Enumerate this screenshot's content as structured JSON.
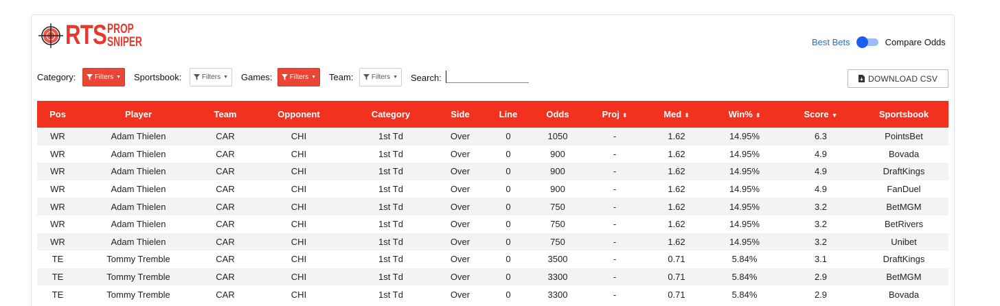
{
  "logo": {
    "main": "RTS",
    "line1": "PROP",
    "line2": "SNIPER"
  },
  "mode_toggle": {
    "left_label": "Best Bets",
    "right_label": "Compare Odds",
    "state": "best-bets"
  },
  "filters": [
    {
      "label": "Category:",
      "button": "Filters",
      "active": true
    },
    {
      "label": "Sportsbook:",
      "button": "Filters",
      "active": false
    },
    {
      "label": "Games:",
      "button": "Filters",
      "active": true
    },
    {
      "label": "Team:",
      "button": "Filters",
      "active": false
    }
  ],
  "search": {
    "label": "Search:",
    "value": ""
  },
  "download_button": "DOWNLOAD CSV",
  "table": {
    "columns": [
      "Pos",
      "Player",
      "Team",
      "Opponent",
      "Category",
      "Side",
      "Line",
      "Odds",
      "Proj",
      "Med",
      "Win%",
      "Score",
      "Sportsbook"
    ],
    "sortable": {
      "Proj": "both",
      "Med": "both",
      "Win%": "both",
      "Score": "desc"
    },
    "rows": [
      [
        "WR",
        "Adam Thielen",
        "CAR",
        "CHI",
        "1st Td",
        "Over",
        "0",
        "1050",
        "-",
        "1.62",
        "14.95%",
        "6.3",
        "PointsBet"
      ],
      [
        "WR",
        "Adam Thielen",
        "CAR",
        "CHI",
        "1st Td",
        "Over",
        "0",
        "900",
        "-",
        "1.62",
        "14.95%",
        "4.9",
        "Bovada"
      ],
      [
        "WR",
        "Adam Thielen",
        "CAR",
        "CHI",
        "1st Td",
        "Over",
        "0",
        "900",
        "-",
        "1.62",
        "14.95%",
        "4.9",
        "DraftKings"
      ],
      [
        "WR",
        "Adam Thielen",
        "CAR",
        "CHI",
        "1st Td",
        "Over",
        "0",
        "900",
        "-",
        "1.62",
        "14.95%",
        "4.9",
        "FanDuel"
      ],
      [
        "WR",
        "Adam Thielen",
        "CAR",
        "CHI",
        "1st Td",
        "Over",
        "0",
        "750",
        "-",
        "1.62",
        "14.95%",
        "3.2",
        "BetMGM"
      ],
      [
        "WR",
        "Adam Thielen",
        "CAR",
        "CHI",
        "1st Td",
        "Over",
        "0",
        "750",
        "-",
        "1.62",
        "14.95%",
        "3.2",
        "BetRivers"
      ],
      [
        "WR",
        "Adam Thielen",
        "CAR",
        "CHI",
        "1st Td",
        "Over",
        "0",
        "750",
        "-",
        "1.62",
        "14.95%",
        "3.2",
        "Unibet"
      ],
      [
        "TE",
        "Tommy Tremble",
        "CAR",
        "CHI",
        "1st Td",
        "Over",
        "0",
        "3500",
        "-",
        "0.71",
        "5.84%",
        "3.1",
        "DraftKings"
      ],
      [
        "TE",
        "Tommy Tremble",
        "CAR",
        "CHI",
        "1st Td",
        "Over",
        "0",
        "3300",
        "-",
        "0.71",
        "5.84%",
        "2.9",
        "BetMGM"
      ],
      [
        "TE",
        "Tommy Tremble",
        "CAR",
        "CHI",
        "1st Td",
        "Over",
        "0",
        "3300",
        "-",
        "0.71",
        "5.84%",
        "2.9",
        "Bovada"
      ]
    ]
  },
  "colors": {
    "accent": "#f2311f",
    "filter_active": "#ea4535",
    "link_blue": "#1a6fe0",
    "toggle_blue": "#1a5ff0"
  }
}
